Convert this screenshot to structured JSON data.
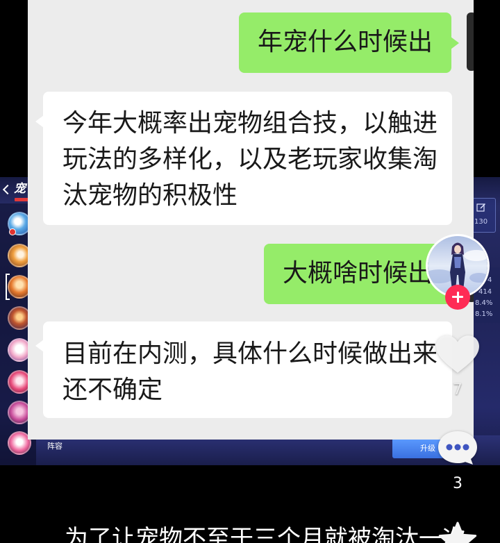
{
  "theme": {
    "page_background": "#000000",
    "chat_background": "#ececec",
    "sent_bubble": "#95ec69",
    "received_bubble": "#ffffff",
    "message_text": "#191919",
    "follow_button": "#fe2c55",
    "game_background": "#1f2356",
    "upgrade_button": "#3a70e0"
  },
  "chat": {
    "messages": [
      {
        "lines": [
          "年宠什么时候出"
        ]
      },
      {
        "lines": [
          "今年大概率出宠物组合技，以触进",
          "玩法的多样化，以及老玩家收集淘",
          "汰宠物的积极性"
        ]
      },
      {
        "lines": [
          "大概啥时候出"
        ]
      },
      {
        "lines": [
          "目前在内测，具体什么时候做出来",
          "还不确定"
        ]
      }
    ]
  },
  "game": {
    "back_icon": "chevron-left-icon",
    "title": "宠",
    "edit_icon": "pencil-icon",
    "stats": [
      "130",
      "4",
      "414",
      "8.4%",
      "8.1%"
    ],
    "lineup_label": "阵容",
    "upgrade_label": "升级"
  },
  "actions": {
    "avatar_icon": "creator-avatar",
    "follow_icon": "plus-icon",
    "like_icon": "heart-icon",
    "like_count": "7",
    "comment_icon": "comment-icon",
    "comment_count": "3",
    "favorite_icon": "star-icon"
  },
  "caption": {
    "text": "为了让宠物不至于三个月就被淘汰一次"
  }
}
